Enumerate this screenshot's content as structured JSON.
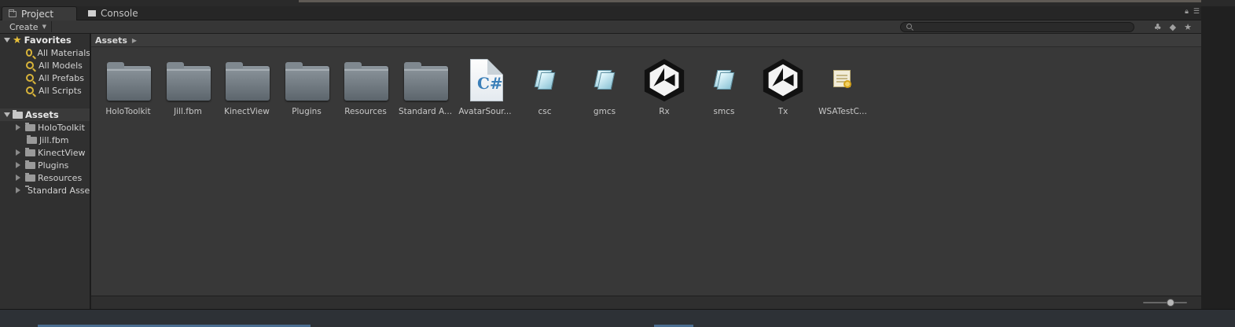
{
  "tabs": [
    {
      "label": "Project",
      "icon": "folder-icon",
      "active": true
    },
    {
      "label": "Console",
      "icon": "console-icon",
      "active": false
    }
  ],
  "toolbar": {
    "create_label": "Create",
    "search_value": "",
    "right_icons": [
      "search-by-type-icon",
      "label-icon",
      "favorite-star-icon"
    ]
  },
  "sidebar": {
    "favorites_header": "Favorites",
    "favorites": [
      {
        "label": "All Materials"
      },
      {
        "label": "All Models"
      },
      {
        "label": "All Prefabs"
      },
      {
        "label": "All Scripts"
      }
    ],
    "assets_header": "Assets",
    "assets": [
      {
        "label": "HoloToolkit",
        "expandable": true
      },
      {
        "label": "Jill.fbm",
        "expandable": false
      },
      {
        "label": "KinectView",
        "expandable": true
      },
      {
        "label": "Plugins",
        "expandable": true
      },
      {
        "label": "Resources",
        "expandable": true
      },
      {
        "label": "Standard Assets",
        "expandable": true
      }
    ]
  },
  "breadcrumb": {
    "label": "Assets"
  },
  "assets": [
    {
      "label": "HoloToolkit",
      "kind": "folder"
    },
    {
      "label": "Jill.fbm",
      "kind": "folder"
    },
    {
      "label": "KinectView",
      "kind": "folder"
    },
    {
      "label": "Plugins",
      "kind": "folder"
    },
    {
      "label": "Resources",
      "kind": "folder"
    },
    {
      "label": "Standard A...",
      "kind": "folder"
    },
    {
      "label": "AvatarSour...",
      "kind": "csharp-script"
    },
    {
      "label": "csc",
      "kind": "dll"
    },
    {
      "label": "gmcs",
      "kind": "dll"
    },
    {
      "label": "Rx",
      "kind": "unity-asset"
    },
    {
      "label": "smcs",
      "kind": "dll"
    },
    {
      "label": "Tx",
      "kind": "unity-asset"
    },
    {
      "label": "WSATestC...",
      "kind": "certificate"
    }
  ],
  "colors": {
    "panel_bg": "#383838",
    "sidebar_bg": "#303030",
    "favorites_star": "#e8c03a",
    "csharp_blue": "#3b7fb8"
  }
}
